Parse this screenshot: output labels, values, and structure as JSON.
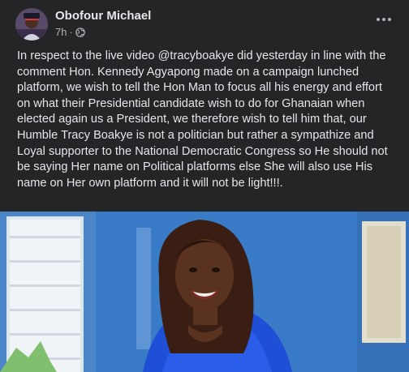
{
  "post": {
    "author": "Obofour Michael",
    "time": "7h",
    "separator": "·",
    "privacy_icon": "globe-icon",
    "more_icon": "more-options-icon",
    "body": "In respect to the live video @tracyboakye did yesterday in line with the comment Hon. Kennedy Agyapong made on a campaign lunched platform, we wish to tell the Hon Man to focus all his energy and effort on what their Presidential candidate wish to do for Ghanaian when elected again us a President, we therefore wish to tell him that, our Humble Tracy Boakye is not a politician but rather a sympathize and Loyal supporter to the National Democratic Congress so He should not be saying Her name on Political platforms else She will also use His name on Her own platform and it will not be light!!!.",
    "photo": "woman-in-blue-dress-photo"
  },
  "colors": {
    "background": "#242526",
    "primary_text": "#e4e6eb",
    "secondary_text": "#b0b3b8",
    "photo_dress_blue": "#1f4fd6"
  }
}
